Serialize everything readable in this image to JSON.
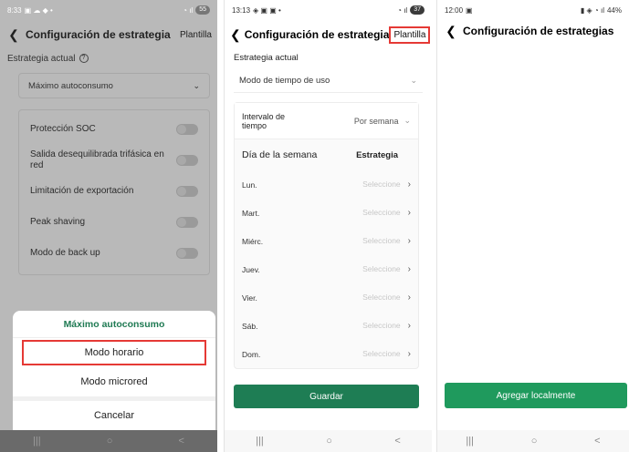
{
  "screen1": {
    "status": {
      "time": "8:33",
      "left_icons": "▣ ☁ ◆ •",
      "right_icons": "◔ ıl",
      "battery": "55"
    },
    "title": "Configuración de estrategia",
    "template_label": "Plantilla",
    "current_label": "Estrategia actual",
    "select_value": "Máximo autoconsumo",
    "toggles": [
      {
        "label": "Protección SOC"
      },
      {
        "label": "Salida desequilibrada trifásica en red"
      },
      {
        "label": "Limitación de exportación"
      },
      {
        "label": "Peak shaving"
      },
      {
        "label": "Modo de back up"
      }
    ],
    "sheet": {
      "title": "Máximo autoconsumo",
      "options": [
        "Modo horario",
        "Modo microred"
      ],
      "cancel": "Cancelar"
    },
    "nav": [
      "|||",
      "○",
      "<"
    ],
    "colors": {
      "accent": "#1f7a53",
      "highlight": "#e53935"
    }
  },
  "screen2": {
    "status": {
      "time": "13:13",
      "left_icons": "◈ ▣ ▣ •",
      "right_icons": "◔ ıl",
      "battery": "37"
    },
    "title": "Configuración de estrategia",
    "template_label": "Plantilla",
    "current_label": "Estrategia actual",
    "select_value": "Modo de tiempo de uso",
    "interval_label": "Intervalo de tiempo",
    "interval_value": "Por semana",
    "day_header": "Día de la semana",
    "strategy_header": "Estrategia",
    "days": [
      {
        "day": "Lun.",
        "value": "Seleccione"
      },
      {
        "day": "Mart.",
        "value": "Seleccione"
      },
      {
        "day": "Miérc.",
        "value": "Seleccione"
      },
      {
        "day": "Juev.",
        "value": "Seleccione"
      },
      {
        "day": "Vier.",
        "value": "Seleccione"
      },
      {
        "day": "Sáb.",
        "value": "Seleccione"
      },
      {
        "day": "Dom.",
        "value": "Seleccione"
      }
    ],
    "save": "Guardar",
    "nav": [
      "|||",
      "○",
      "<"
    ]
  },
  "screen3": {
    "status": {
      "time": "12:00",
      "left_icons": "▣",
      "right_icons": "▮ ◈ ◔ ıl",
      "battery": "44%"
    },
    "title": "Configuración de estrategias",
    "add_button": "Agregar localmente",
    "nav": [
      "|||",
      "○",
      "<"
    ]
  }
}
